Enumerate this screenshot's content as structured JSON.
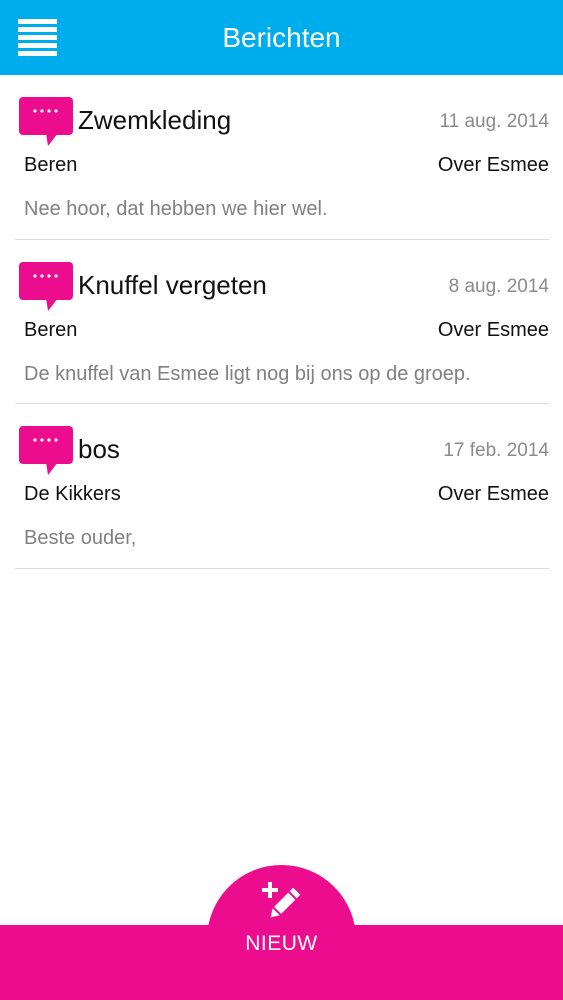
{
  "header": {
    "title": "Berichten",
    "menu_icon": "hamburger-menu-icon",
    "background": "#00adec"
  },
  "messages": [
    {
      "icon": "speech-bubble-icon",
      "subject": "Zwemkleding",
      "date": "11 aug. 2014",
      "group": "Beren",
      "about": "Over Esmee",
      "preview": "Nee hoor, dat hebben we hier wel."
    },
    {
      "icon": "speech-bubble-icon",
      "subject": "Knuffel vergeten",
      "date": "8 aug. 2014",
      "group": "Beren",
      "about": "Over Esmee",
      "preview": "De knuffel van Esmee ligt nog bij ons op de groep."
    },
    {
      "icon": "speech-bubble-icon",
      "subject": "bos",
      "date": "17 feb. 2014",
      "group": "De Kikkers",
      "about": "Over Esmee",
      "preview": "Beste ouder,"
    }
  ],
  "footer": {
    "new_label": "NIEUW",
    "new_icon": "compose-plus-pencil-icon",
    "accent": "#ec0d8f"
  }
}
